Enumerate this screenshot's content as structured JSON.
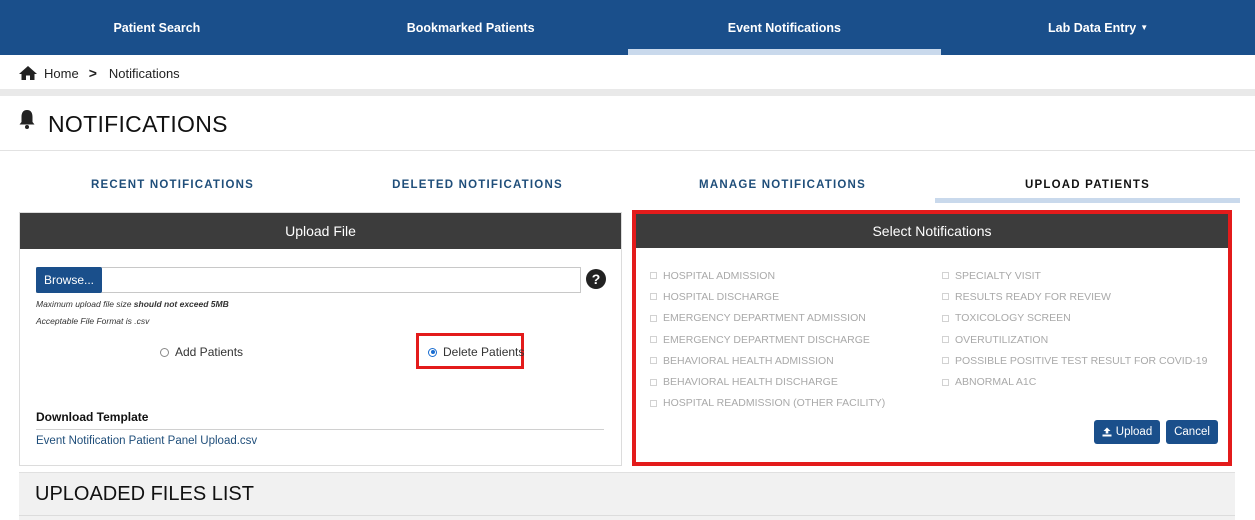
{
  "topnav": {
    "items": [
      {
        "label": "Patient Search"
      },
      {
        "label": "Bookmarked Patients"
      },
      {
        "label": "Event Notifications"
      },
      {
        "label": "Lab Data Entry"
      }
    ],
    "active_index": 2
  },
  "breadcrumb": {
    "home": "Home",
    "current": "Notifications"
  },
  "page": {
    "title": "NOTIFICATIONS"
  },
  "tabs": {
    "items": [
      {
        "label": "RECENT NOTIFICATIONS"
      },
      {
        "label": "DELETED NOTIFICATIONS"
      },
      {
        "label": "MANAGE NOTIFICATIONS"
      },
      {
        "label": "UPLOAD PATIENTS"
      }
    ],
    "active_index": 3
  },
  "upload": {
    "header": "Upload File",
    "browse_label": "Browse...",
    "help_symbol": "?",
    "file_value": "",
    "hint_size_prefix": "Maximum upload file size ",
    "hint_size_bold": "should not exceed 5MB",
    "hint_format": "Acceptable File Format is .csv",
    "add_label": "Add Patients",
    "delete_label": "Delete Patients",
    "selected_option": "delete",
    "download_label": "Download Template",
    "download_link": "Event Notification Patient Panel Upload.csv"
  },
  "select": {
    "header": "Select Notifications",
    "left": [
      "HOSPITAL ADMISSION",
      "HOSPITAL DISCHARGE",
      "EMERGENCY DEPARTMENT ADMISSION",
      "EMERGENCY DEPARTMENT DISCHARGE",
      "BEHAVIORAL HEALTH ADMISSION",
      "BEHAVIORAL HEALTH DISCHARGE",
      "HOSPITAL READMISSION (OTHER FACILITY)"
    ],
    "right": [
      "SPECIALTY VISIT",
      "RESULTS READY FOR REVIEW",
      "TOXICOLOGY SCREEN",
      "OVERUTILIZATION",
      "POSSIBLE POSITIVE TEST RESULT FOR COVID-19",
      "ABNORMAL A1C"
    ],
    "upload_label": "Upload",
    "cancel_label": "Cancel"
  },
  "files_list": {
    "title": "UPLOADED FILES LIST"
  },
  "colors": {
    "nav": "#1a4f8b",
    "highlight": "#e31b1b",
    "panel_header": "#3c3c3c"
  }
}
